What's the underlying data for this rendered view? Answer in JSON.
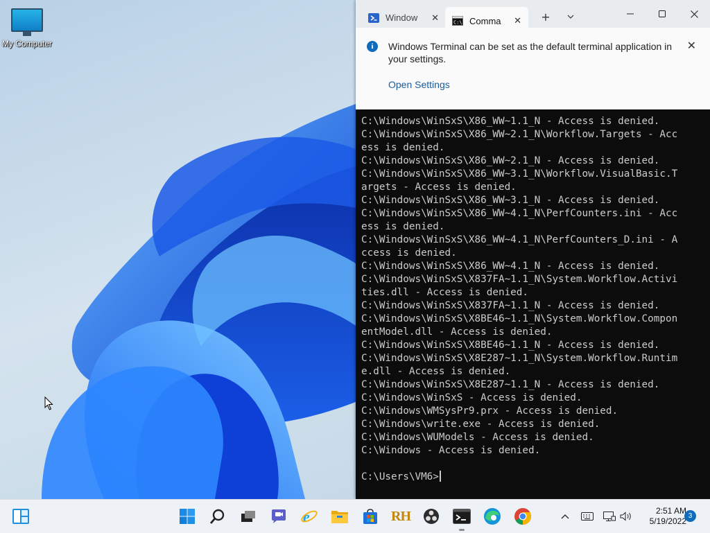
{
  "desktop": {
    "icons": [
      {
        "label": "My Computer",
        "icon": "monitor-icon"
      }
    ]
  },
  "terminal": {
    "tabs": [
      {
        "label": "Window",
        "icon": "powershell-icon",
        "close": "✕"
      },
      {
        "label": "Comma",
        "icon": "cmd-icon",
        "close": "✕",
        "active": true
      }
    ],
    "new_tab": "+",
    "dropdown": "⌄",
    "window_controls": {
      "minimize": "—",
      "maximize": "☐",
      "close": "✕"
    },
    "infobar": {
      "message": "Windows Terminal can be set as the default terminal application in your settings.",
      "link": "Open Settings",
      "close": "✕"
    },
    "console_lines": [
      "C:\\Windows\\WinSxS\\X86_WW~1.1_N - Access is denied.",
      "C:\\Windows\\WinSxS\\X86_WW~2.1_N\\Workflow.Targets - Acc",
      "ess is denied.",
      "C:\\Windows\\WinSxS\\X86_WW~2.1_N - Access is denied.",
      "C:\\Windows\\WinSxS\\X86_WW~3.1_N\\Workflow.VisualBasic.T",
      "argets - Access is denied.",
      "C:\\Windows\\WinSxS\\X86_WW~3.1_N - Access is denied.",
      "C:\\Windows\\WinSxS\\X86_WW~4.1_N\\PerfCounters.ini - Acc",
      "ess is denied.",
      "C:\\Windows\\WinSxS\\X86_WW~4.1_N\\PerfCounters_D.ini - A",
      "ccess is denied.",
      "C:\\Windows\\WinSxS\\X86_WW~4.1_N - Access is denied.",
      "C:\\Windows\\WinSxS\\X837FA~1.1_N\\System.Workflow.Activi",
      "ties.dll - Access is denied.",
      "C:\\Windows\\WinSxS\\X837FA~1.1_N - Access is denied.",
      "C:\\Windows\\WinSxS\\X8BE46~1.1_N\\System.Workflow.Compon",
      "entModel.dll - Access is denied.",
      "C:\\Windows\\WinSxS\\X8BE46~1.1_N - Access is denied.",
      "C:\\Windows\\WinSxS\\X8E287~1.1_N\\System.Workflow.Runtim",
      "e.dll - Access is denied.",
      "C:\\Windows\\WinSxS\\X8E287~1.1_N - Access is denied.",
      "C:\\Windows\\WinSxS - Access is denied.",
      "C:\\Windows\\WMSysPr9.prx - Access is denied.",
      "C:\\Windows\\write.exe - Access is denied.",
      "C:\\Windows\\WUModels - Access is denied.",
      "C:\\Windows - Access is denied.",
      "",
      "C:\\Users\\VM6>"
    ]
  },
  "taskbar": {
    "widgets_icon": "widgets-icon",
    "apps": [
      {
        "name": "start-button",
        "icon": "windows-logo-icon"
      },
      {
        "name": "search-button",
        "icon": "search-icon"
      },
      {
        "name": "task-view-button",
        "icon": "task-view-icon"
      },
      {
        "name": "chat-button",
        "icon": "chat-icon"
      },
      {
        "name": "internet-explorer-button",
        "icon": "internet-explorer-icon"
      },
      {
        "name": "file-explorer-button",
        "icon": "folder-icon"
      },
      {
        "name": "store-button",
        "icon": "store-icon"
      },
      {
        "name": "resource-hacker-button",
        "icon": "rh-icon",
        "text": "RH"
      },
      {
        "name": "obs-button",
        "icon": "obs-icon"
      },
      {
        "name": "terminal-button",
        "icon": "terminal-icon",
        "active": true
      },
      {
        "name": "edge-button",
        "icon": "edge-icon"
      },
      {
        "name": "chrome-button",
        "icon": "chrome-icon"
      }
    ],
    "tray": {
      "chevron": "^",
      "keyboard_icon": "keyboard-icon",
      "network_icon": "network-icon",
      "volume_icon": "volume-icon"
    },
    "clock": {
      "time": "2:51 AM",
      "date": "5/19/2022"
    },
    "notification_count": "3"
  },
  "colors": {
    "accent": "#0f6cbd",
    "console_bg": "#0c0c0c",
    "console_fg": "#cccccc",
    "taskbar_bg": "#eef1f5"
  }
}
